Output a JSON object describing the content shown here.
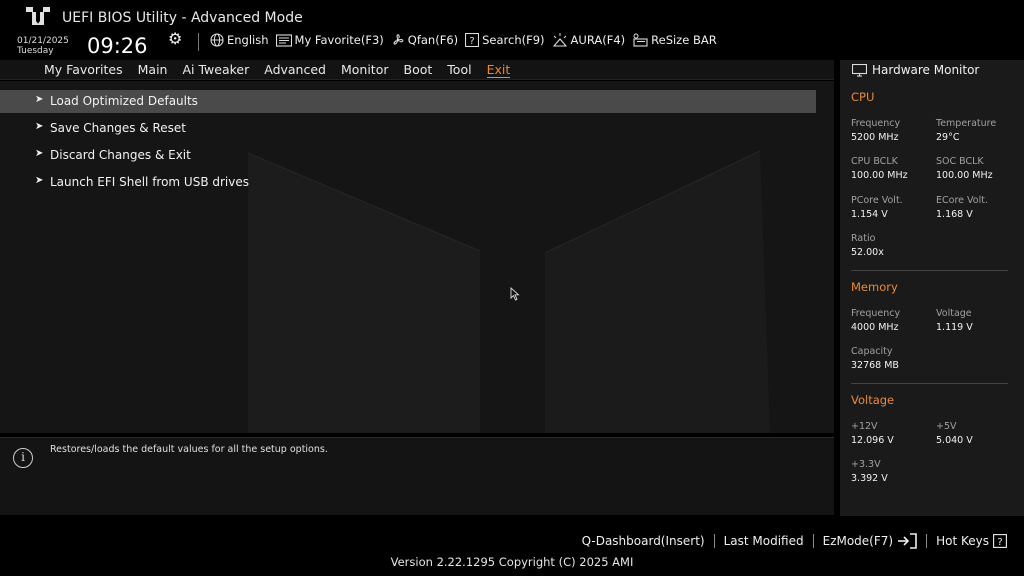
{
  "app": {
    "title": "UEFI BIOS Utility - Advanced Mode"
  },
  "datetime": {
    "date": "01/21/2025",
    "weekday": "Tuesday",
    "time": "09:26"
  },
  "toolbar": [
    {
      "icon": "globe-icon",
      "label": "English"
    },
    {
      "icon": "favorite-icon",
      "label": "My Favorite(F3)"
    },
    {
      "icon": "fan-icon",
      "label": "Qfan(F6)"
    },
    {
      "icon": "search-icon",
      "label": "Search(F9)"
    },
    {
      "icon": "aura-icon",
      "label": "AURA(F4)"
    },
    {
      "icon": "resize-bar-icon",
      "label": "ReSize BAR"
    }
  ],
  "tabs": [
    "My Favorites",
    "Main",
    "Ai Tweaker",
    "Advanced",
    "Monitor",
    "Boot",
    "Tool",
    "Exit"
  ],
  "active_tab": "Exit",
  "menu": [
    {
      "label": "Load Optimized Defaults"
    },
    {
      "label": "Save Changes & Reset"
    },
    {
      "label": "Discard Changes & Exit"
    },
    {
      "label": "Launch EFI Shell from USB drives"
    }
  ],
  "help": {
    "text": "Restores/loads the default values for all the setup options."
  },
  "hardware_monitor": {
    "title": "Hardware Monitor",
    "cpu": {
      "heading": "CPU",
      "frequency_label": "Frequency",
      "frequency": "5200 MHz",
      "temperature_label": "Temperature",
      "temperature": "29°C",
      "cpu_bclk_label": "CPU BCLK",
      "cpu_bclk": "100.00 MHz",
      "soc_bclk_label": "SOC BCLK",
      "soc_bclk": "100.00 MHz",
      "pcore_label": "PCore Volt.",
      "pcore": "1.154 V",
      "ecore_label": "ECore Volt.",
      "ecore": "1.168 V",
      "ratio_label": "Ratio",
      "ratio": "52.00x"
    },
    "memory": {
      "heading": "Memory",
      "frequency_label": "Frequency",
      "frequency": "4000 MHz",
      "voltage_label": "Voltage",
      "voltage": "1.119 V",
      "capacity_label": "Capacity",
      "capacity": "32768 MB"
    },
    "voltage": {
      "heading": "Voltage",
      "v12_label": "+12V",
      "v12": "12.096 V",
      "v5_label": "+5V",
      "v5": "5.040 V",
      "v33_label": "+3.3V",
      "v33": "3.392 V"
    }
  },
  "footer": {
    "q_dashboard": "Q-Dashboard(Insert)",
    "last_modified": "Last Modified",
    "ezmode": "EzMode(F7)",
    "hotkeys": "Hot Keys",
    "version": "Version 2.22.1295 Copyright (C) 2025 AMI"
  },
  "colors": {
    "accent": "#f0872a",
    "selected_bg": "#4a4a4a",
    "panel_bg": "#1a1a1a"
  }
}
